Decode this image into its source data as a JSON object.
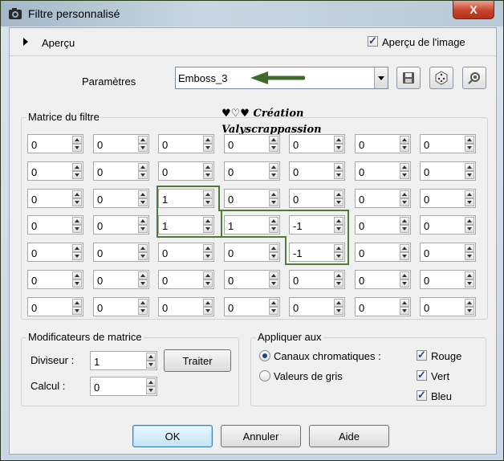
{
  "window": {
    "title": "Filtre personnalisé",
    "close_glyph": "X"
  },
  "preview": {
    "label": "Aperçu",
    "image_preview_label": "Aperçu de l'image",
    "image_preview_checked": true
  },
  "params": {
    "label": "Paramètres",
    "preset_value": "Emboss_3"
  },
  "matrix": {
    "title": "Matrice du filtre",
    "watermark_line1": "♥♡♥ Création",
    "watermark_line2": "Valyscrappassion",
    "rows": [
      [
        "0",
        "0",
        "0",
        "0",
        "0",
        "0",
        "0"
      ],
      [
        "0",
        "0",
        "0",
        "0",
        "0",
        "0",
        "0"
      ],
      [
        "0",
        "0",
        "1",
        "0",
        "0",
        "0",
        "0"
      ],
      [
        "0",
        "0",
        "1",
        "1",
        "-1",
        "0",
        "0"
      ],
      [
        "0",
        "0",
        "0",
        "0",
        "-1",
        "0",
        "0"
      ],
      [
        "0",
        "0",
        "0",
        "0",
        "0",
        "0",
        "0"
      ],
      [
        "0",
        "0",
        "0",
        "0",
        "0",
        "0",
        "0"
      ]
    ]
  },
  "modifiers": {
    "title": "Modificateurs de matrice",
    "divisor_label": "Diviseur :",
    "divisor_value": "1",
    "bias_label": "Calcul :",
    "bias_value": "0",
    "apply_button": "Traiter"
  },
  "apply_to": {
    "title": "Appliquer aux",
    "color_channels": "Canaux chromatiques :",
    "grayscale": "Valeurs de gris",
    "red": "Rouge",
    "green": "Vert",
    "blue": "Bleu"
  },
  "buttons": {
    "ok": "OK",
    "cancel": "Annuler",
    "help": "Aide"
  },
  "colors": {
    "highlight_green": "#4f7a3a",
    "arrow_green": "#3f6b2a"
  }
}
